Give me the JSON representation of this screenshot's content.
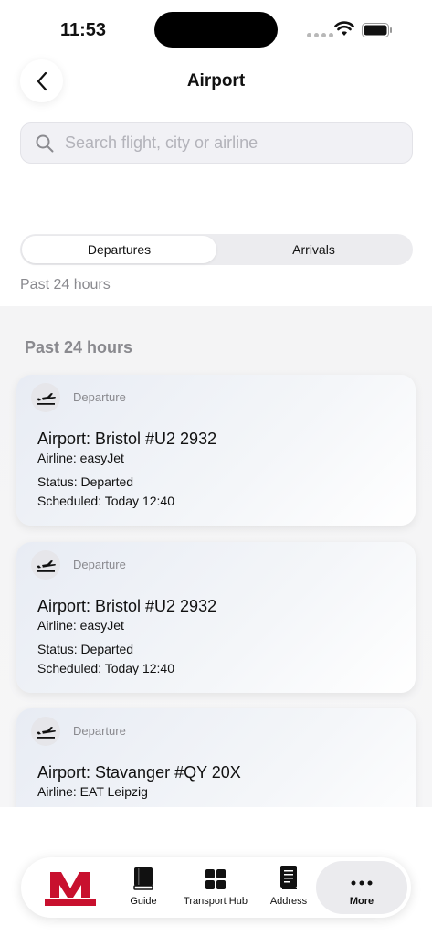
{
  "status_bar": {
    "time": "11:53"
  },
  "header": {
    "title": "Airport"
  },
  "search": {
    "placeholder": "Search flight, city or airline",
    "value": ""
  },
  "segments": {
    "departures": "Departures",
    "arrivals": "Arrivals",
    "selected": "Departures"
  },
  "filter_label": "Past 24 hours",
  "section_title": "Past 24 hours",
  "flights": [
    {
      "type": "Departure",
      "airport": "Airport: Bristol #U2 2932",
      "airline": "Airline: easyJet",
      "status": "Status: Departed",
      "scheduled": "Scheduled: Today 12:40"
    },
    {
      "type": "Departure",
      "airport": "Airport: Bristol #U2 2932",
      "airline": "Airline: easyJet",
      "status": "Status: Departed",
      "scheduled": "Scheduled: Today 12:40"
    },
    {
      "type": "Departure",
      "airport": "Airport: Stavanger #QY 20X",
      "airline": "Airline: EAT Leipzig",
      "status": "",
      "scheduled": ""
    }
  ],
  "tabbar": {
    "logo_icon": "metro-m-logo",
    "guide": "Guide",
    "transport_hub": "Transport Hub",
    "address": "Address",
    "more": "More"
  },
  "colors": {
    "logo_red": "#c8102e"
  }
}
